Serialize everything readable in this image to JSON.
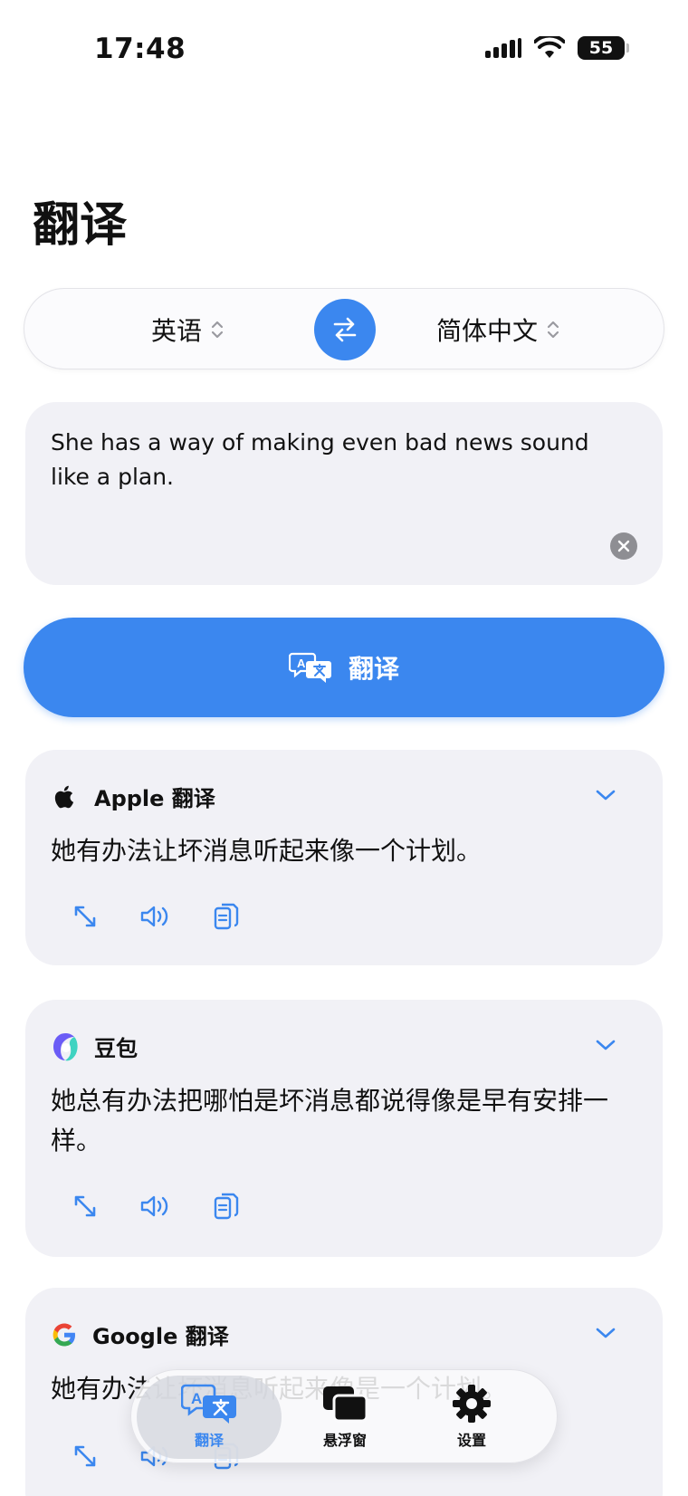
{
  "status": {
    "time": "17:48",
    "battery": "55"
  },
  "page": {
    "title": "翻译"
  },
  "languages": {
    "source": "英语",
    "target": "简体中文"
  },
  "input": {
    "text": "She has a way of making even bad news sound like a plan."
  },
  "translate_button": {
    "label": "翻译"
  },
  "results": [
    {
      "provider": "Apple 翻译",
      "icon": "apple-logo",
      "text": "她有办法让坏消息听起来像一个计划。"
    },
    {
      "provider": "豆包",
      "icon": "doubao-logo",
      "text": "她总有办法把哪怕是坏消息都说得像是早有安排一样。"
    },
    {
      "provider": "Google 翻译",
      "icon": "google-logo",
      "text": "她有办法让坏消息听起来像是一个计划。"
    }
  ],
  "tabs": [
    {
      "label": "翻译",
      "icon": "translate-icon",
      "active": true
    },
    {
      "label": "悬浮窗",
      "icon": "floating-window-icon",
      "active": false
    },
    {
      "label": "设置",
      "icon": "gear-icon",
      "active": false
    }
  ],
  "colors": {
    "accent": "#3b87ef",
    "card": "#f1f1f6"
  }
}
